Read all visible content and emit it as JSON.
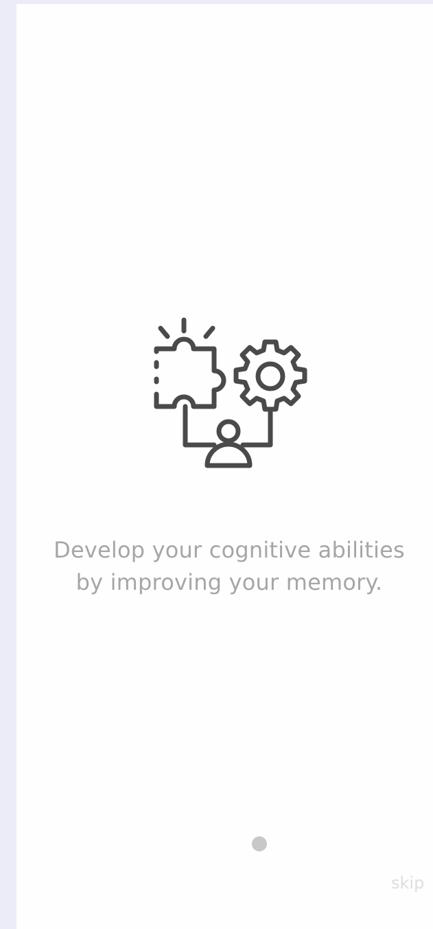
{
  "onboarding": {
    "illustration_icon": "puzzle-gear-person-icon",
    "tagline_line_1": "Develop your cognitive abilities",
    "tagline_line_2": "by improving your memory.",
    "page_indicator": {
      "current": 1,
      "total": 1
    },
    "skip_label": "skip"
  },
  "colors": {
    "background": "#ecebf8",
    "screen": "#fefefe",
    "icon": "#4a4a4a",
    "text": "#a6a6a6",
    "dot": "#c8c8c8",
    "skip": "#dedede"
  }
}
